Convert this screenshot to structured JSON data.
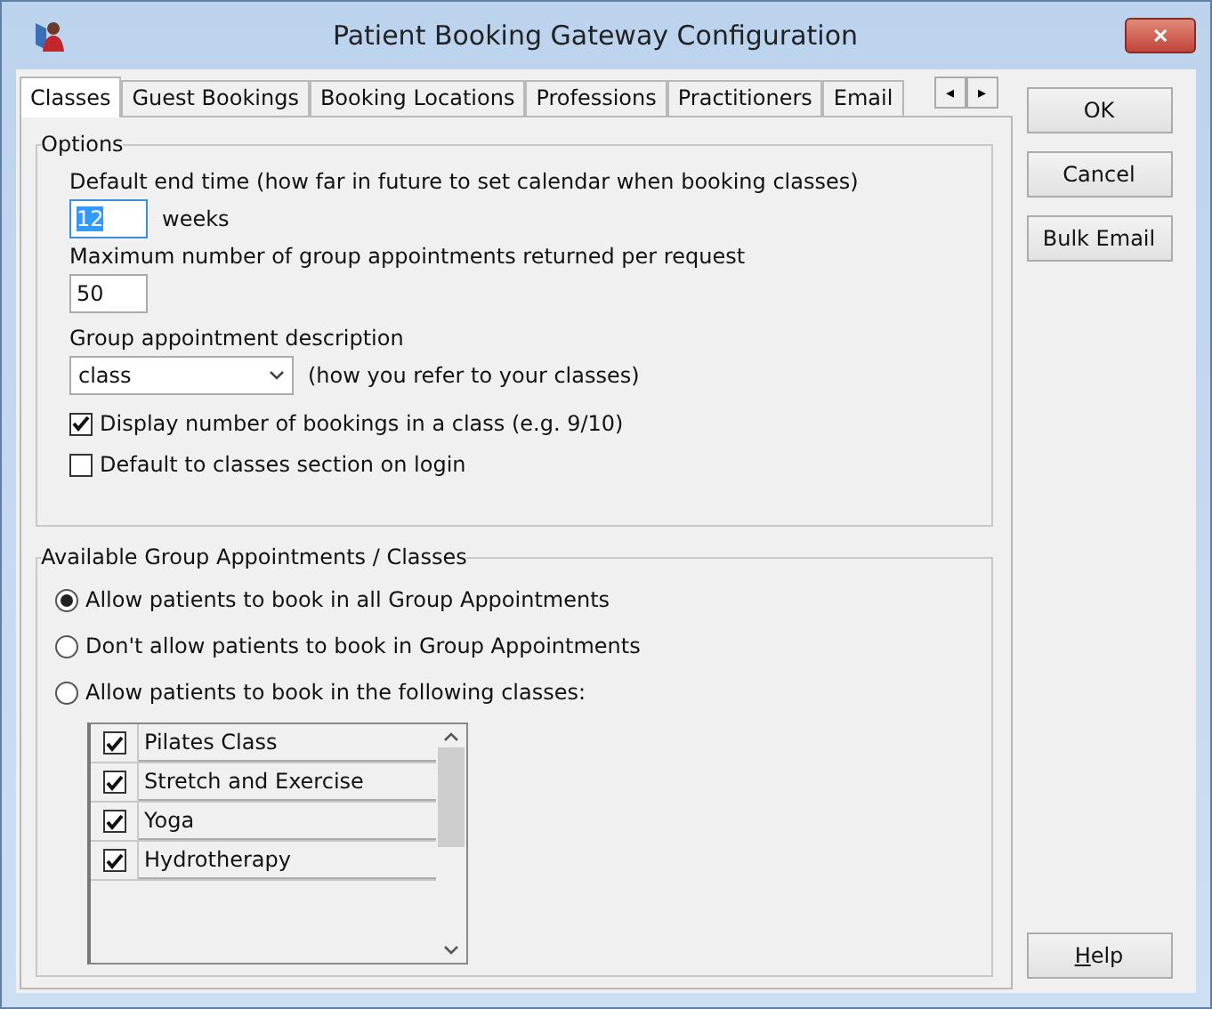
{
  "window": {
    "title": "Patient Booking Gateway Configuration",
    "close": "✕"
  },
  "tabs": [
    {
      "label": "Classes",
      "selected": true
    },
    {
      "label": "Guest Bookings",
      "selected": false
    },
    {
      "label": "Booking Locations",
      "selected": false
    },
    {
      "label": "Professions",
      "selected": false
    },
    {
      "label": "Practitioners",
      "selected": false
    },
    {
      "label": "Email",
      "selected": false
    }
  ],
  "tab_scroll": [
    "◂",
    "▸"
  ],
  "options": {
    "title": "Options",
    "end_time_label": "Default end time (how far in future to set calendar when booking classes)",
    "end_time_value": "12",
    "end_time_unit": "weeks",
    "max_label": "Maximum number of group appointments returned per request",
    "max_value": "50",
    "desc_label": "Group appointment description",
    "desc_value": "class",
    "desc_hint": "(how you refer to your classes)",
    "checkboxes": [
      {
        "label": "Display number of bookings in a class (e.g. 9/10)",
        "checked": true
      },
      {
        "label": "Default to classes section on login",
        "checked": false
      }
    ]
  },
  "available": {
    "title": "Available Group Appointments / Classes",
    "radios": [
      {
        "label": "Allow patients to book in all Group Appointments",
        "selected": true
      },
      {
        "label": "Don't allow patients to book in Group Appointments",
        "selected": false
      },
      {
        "label": "Allow patients to book in the following classes:",
        "selected": false
      }
    ],
    "classes": [
      {
        "label": "Pilates Class",
        "checked": true
      },
      {
        "label": "Stretch and Exercise",
        "checked": true
      },
      {
        "label": "Yoga",
        "checked": true
      },
      {
        "label": "Hydrotherapy",
        "checked": true
      }
    ]
  },
  "buttons": [
    {
      "label": "OK",
      "accelerator": false
    },
    {
      "label": "Cancel",
      "accelerator": false
    },
    {
      "label": "Bulk Email",
      "accelerator": false
    }
  ],
  "help_button": {
    "label": "Help",
    "accelerator": true
  }
}
